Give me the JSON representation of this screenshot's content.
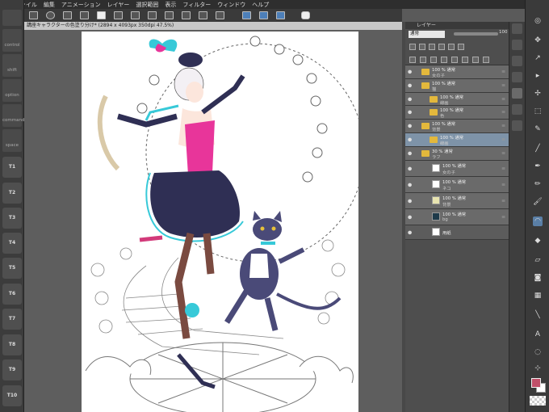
{
  "menubar": {
    "items": [
      "ファイル",
      "編集",
      "アニメーション",
      "レイヤー",
      "選択範囲",
      "表示",
      "フィルター",
      "ウィンドウ",
      "ヘルプ"
    ]
  },
  "document": {
    "tab_title": "講座キャラクターの色塗り分け* (2894 x 4093px 350dpi 47.5%)"
  },
  "edgebar": {
    "buttons": [
      "control",
      "shift",
      "option",
      "command",
      "space"
    ],
    "tabs": [
      "T1",
      "T2",
      "T3",
      "T4",
      "T5",
      "T6",
      "T7",
      "T8",
      "T9",
      "T10"
    ]
  },
  "layer_panel": {
    "title": "レイヤー",
    "blend_mode": "通常",
    "opacity": "100",
    "layers": [
      {
        "l1": "100 % 通常",
        "l2": "女の子",
        "type": "folder"
      },
      {
        "l1": "100 % 通常",
        "l2": "猫",
        "type": "folder"
      },
      {
        "l1": "100 % 通常",
        "l2": "線画",
        "type": "folder"
      },
      {
        "l1": "100 % 通常",
        "l2": "色",
        "type": "folder"
      },
      {
        "l1": "100 % 通常",
        "l2": "背景",
        "type": "folder"
      },
      {
        "l1": "100 % 通常",
        "l2": "線画",
        "type": "folder"
      },
      {
        "l1": "30 % 通常",
        "l2": "ラフ",
        "type": "folder"
      },
      {
        "l1": "100 % 通常",
        "l2": "女の子",
        "type": "layer"
      },
      {
        "l1": "100 % 通常",
        "l2": "ネコ",
        "type": "layer"
      },
      {
        "l1": "100 % 通常",
        "l2": "背景",
        "type": "layer"
      },
      {
        "l1": "100 % 通常",
        "l2": "bg",
        "type": "layer"
      },
      {
        "l1": "",
        "l2": "用紙",
        "type": "paper"
      }
    ]
  },
  "colors": {
    "main": "#c0506a",
    "sub": "#ffffff",
    "accent_cyan": "#37c9d8",
    "dress_pink": "#e8359a",
    "navy": "#2f2f54"
  }
}
